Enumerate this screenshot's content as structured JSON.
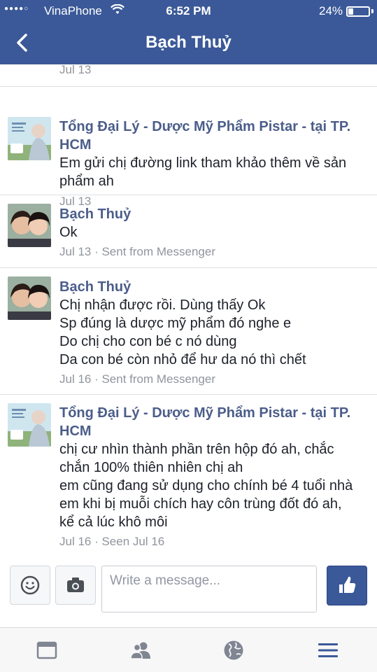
{
  "status_bar": {
    "carrier": "VinaPhone",
    "time": "6:52 PM",
    "battery_text": "24%",
    "battery_level": 0.24,
    "signal_icon": "signal-dots-icon",
    "wifi_icon": "wifi-icon"
  },
  "nav": {
    "title": "Bạch Thuỷ",
    "back_icon": "chevron-left-icon"
  },
  "thread": {
    "top_meta": "Jul 13",
    "messages": [
      {
        "sender": "Tổng Đại Lý - Dược Mỹ Phẩm Pistar - tại TP. HCM",
        "lines": [
          "Em gửi chị đường link tham khảo thêm về sản",
          "phẩm ah"
        ],
        "meta": "Jul 13"
      },
      {
        "sender": "Bạch Thuỷ",
        "lines": [
          "Ok"
        ],
        "meta": "Jul 13 · Sent from Messenger"
      },
      {
        "sender": "Bạch Thuỷ",
        "lines": [
          "Chị nhận được rồi. Dùng thấy Ok",
          "Sp đúng là dược mỹ phẩm đó nghe e",
          "Do chị cho con bé c nó dùng",
          "Da con bé còn nhỏ để hư da nó thì chết"
        ],
        "meta": "Jul 16 · Sent from Messenger"
      },
      {
        "sender": "Tổng Đại Lý - Dược Mỹ Phẩm Pistar - tại TP. HCM",
        "lines": [
          "chị cư nhìn thành phần trên hộp đó ah, chắc",
          "chắn 100% thiên nhiên chị ah",
          "em cũng đang sử dụng cho chính bé 4 tuổi nhà",
          "em khi bị muỗi chích hay côn trùng đốt đó ah,",
          "kể cả lúc khô môi"
        ],
        "meta": "Jul 16 · Seen Jul 16"
      }
    ]
  },
  "composer": {
    "placeholder": "Write a message...",
    "emoji_icon": "smiley-icon",
    "camera_icon": "camera-icon",
    "like_icon": "thumbs-up-icon"
  },
  "tabbar": {
    "items": [
      "news-feed-icon",
      "friends-icon",
      "globe-icon",
      "menu-icon"
    ]
  },
  "colors": {
    "brand": "#3b5998",
    "sender_name": "#4b5d8a",
    "meta_text": "#90949c"
  }
}
